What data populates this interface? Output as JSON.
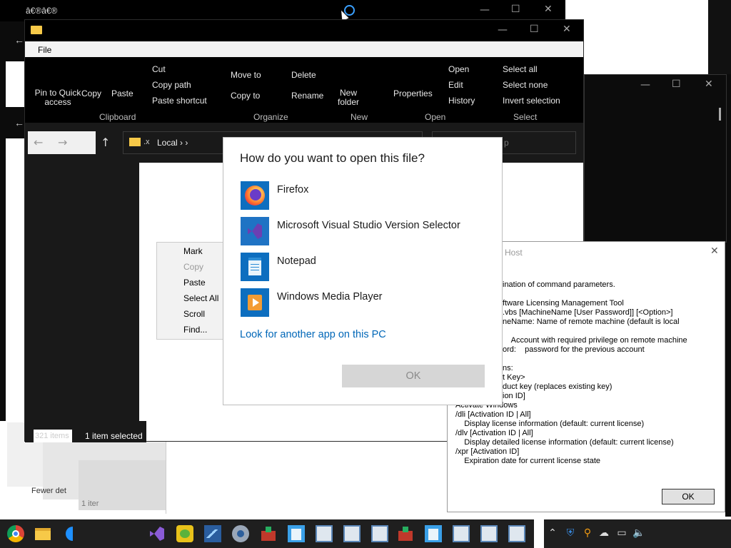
{
  "back_window": {
    "title": "â€®â€®"
  },
  "explorer": {
    "menu_file": "File",
    "ribbon": {
      "pin": "Pin to Quick access",
      "copy": "Copy",
      "paste": "Paste",
      "cut": "Cut",
      "copy_path": "Copy path",
      "paste_shortcut": "Paste shortcut",
      "move_to": "Move to",
      "copy_to": "Copy to",
      "delete": "Delete",
      "rename": "Rename",
      "new_folder": "New folder",
      "properties": "Properties",
      "open": "Open",
      "edit": "Edit",
      "history": "History",
      "select_all": "Select all",
      "select_none": "Select none",
      "invert_selection": "Invert selection",
      "group_clipboard": "Clipboard",
      "group_organize": "Organize",
      "group_new": "New",
      "group_open": "Open",
      "group_select": "Select"
    },
    "address": "Local › ›",
    "address_prefix": ".x",
    "search_placeholder": "p",
    "status_items": "321 items",
    "status_selected": "1 item selected"
  },
  "context_menu": {
    "mark": "Mark",
    "copy": "Copy",
    "paste": "Paste",
    "select_all": "Select All",
    "scroll": "Scroll",
    "find": "Find..."
  },
  "open_with": {
    "title": "How do you want to open this file?",
    "apps": [
      {
        "label": "Firefox"
      },
      {
        "label": "Microsoft Visual Studio Version Selector"
      },
      {
        "label": "Notepad"
      },
      {
        "label": "Windows Media Player"
      }
    ],
    "more_apps": "Look for another app on this PC",
    "ok": "OK"
  },
  "script_host": {
    "title": "ipt Host",
    "lines": [
      "ination of command parameters.",
      "ftware Licensing Management Tool",
      ".vbs [MachineName [User Password]] [<Option>]",
      "neName: Name of remote machine (default is local",
      "    Account with required privilege on remote machine",
      "ord:    password for the previous account",
      "ns:",
      "t Key>",
      "duct key (replaces existing key)",
      "ion ID]",
      "Activate Windows",
      "/dli [Activation ID | All]",
      "    Display license information (default: current license)",
      "/dlv [Activation ID | All]",
      "    Display detailed license information (default: current license)",
      "/xpr [Activation ID]",
      "    Expiration date for current license state"
    ],
    "ok": "OK"
  },
  "background": {
    "fewer_details": "Fewer det",
    "item_count": "1 iter"
  },
  "colors": {
    "accent": "#0067b8",
    "explorer_bg": "#191919",
    "taskbar_bg": "#1f1f1f"
  }
}
